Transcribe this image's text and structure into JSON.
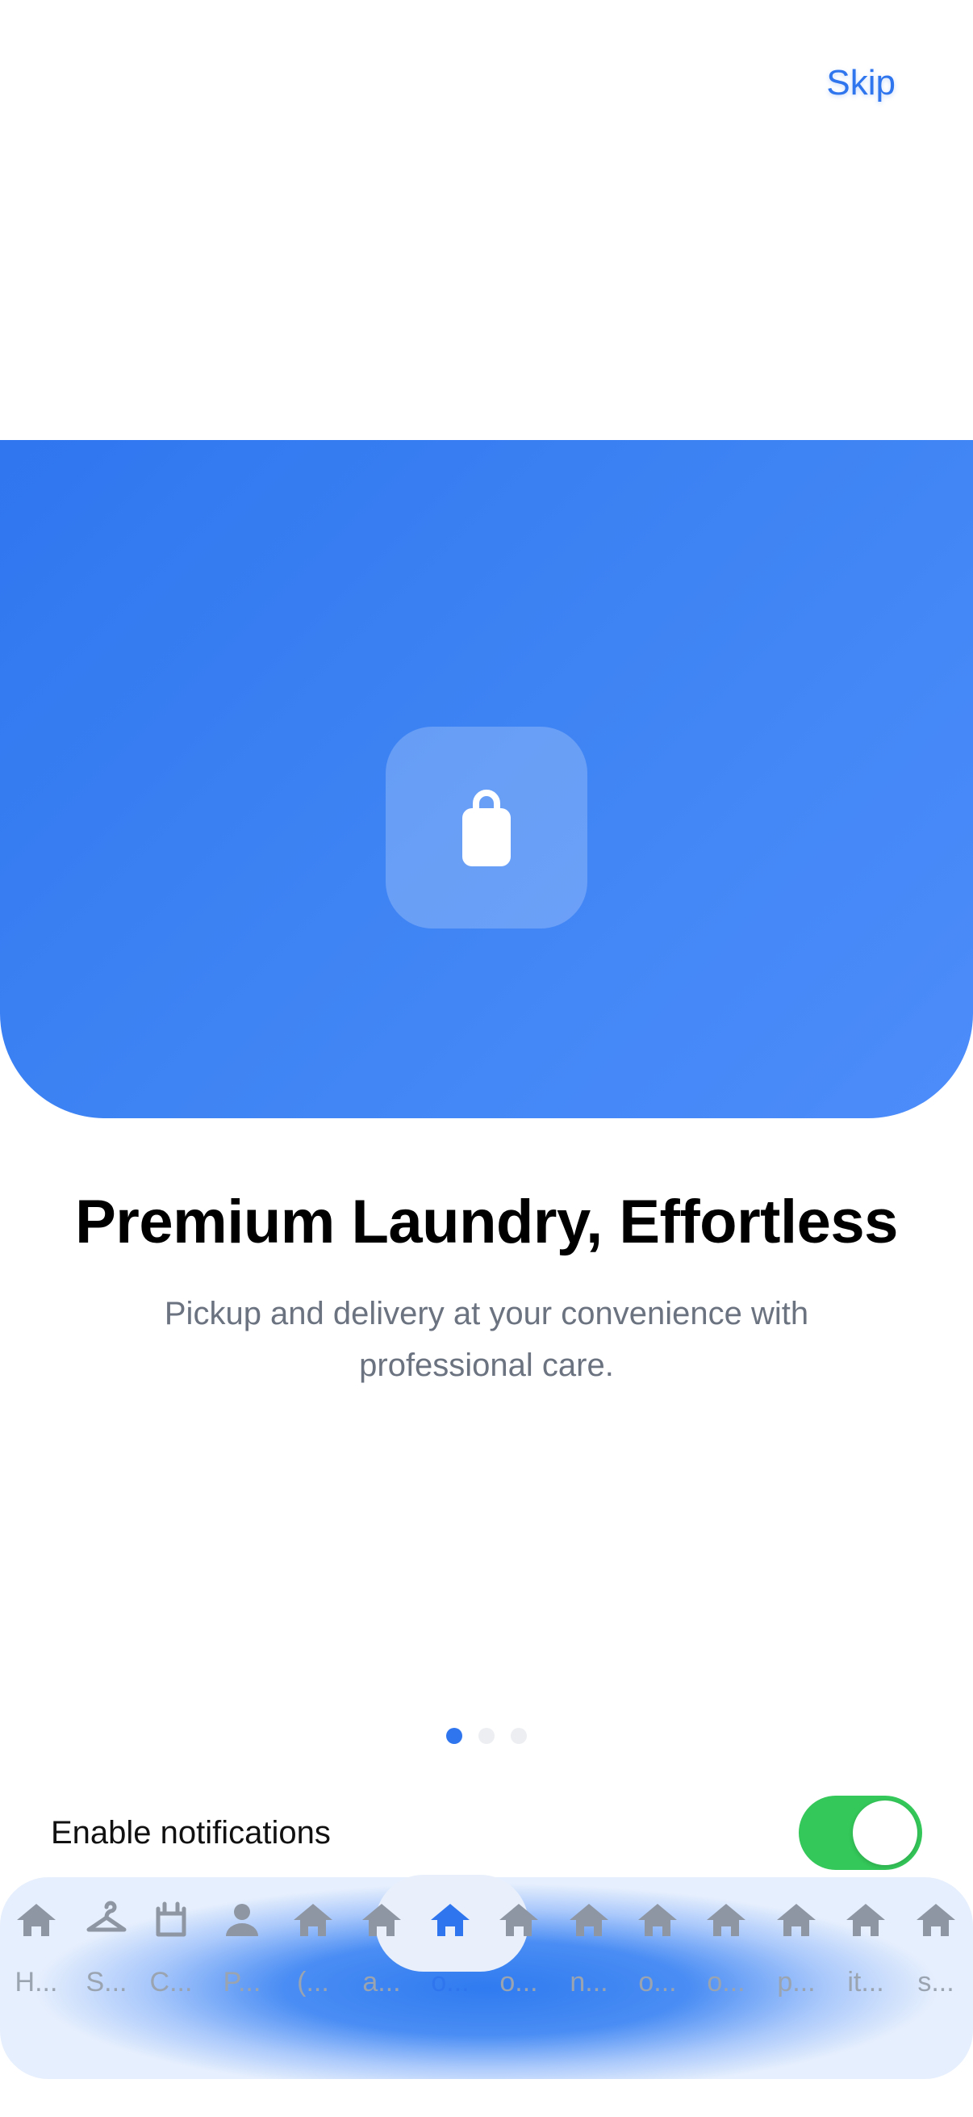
{
  "header": {
    "skip_label": "Skip"
  },
  "hero": {
    "icon": "shopping-bag-icon",
    "gradient_start": "#2f76ef",
    "gradient_end": "#4c8cfa"
  },
  "onboarding": {
    "title": "Premium Laundry, Effortless",
    "subtitle": "Pickup and delivery at your convenience with professional care.",
    "page_count": 3,
    "active_page": 1
  },
  "notifications": {
    "label": "Enable notifications",
    "enabled": true,
    "toggle_color": "#34c759"
  },
  "tabbar": {
    "active_index": 6,
    "accent": "#2f76ee",
    "tabs": [
      {
        "label": "H...",
        "icon": "home-icon"
      },
      {
        "label": "S...",
        "icon": "hanger-icon"
      },
      {
        "label": "C...",
        "icon": "basket-icon"
      },
      {
        "label": "P...",
        "icon": "person-icon"
      },
      {
        "label": "(...",
        "icon": "home-icon"
      },
      {
        "label": "a...",
        "icon": "home-icon"
      },
      {
        "label": "o...",
        "icon": "home-icon"
      },
      {
        "label": "o...",
        "icon": "home-icon"
      },
      {
        "label": "n...",
        "icon": "home-icon"
      },
      {
        "label": "o...",
        "icon": "home-icon"
      },
      {
        "label": "o...",
        "icon": "home-icon"
      },
      {
        "label": "p...",
        "icon": "home-icon"
      },
      {
        "label": "it...",
        "icon": "home-icon"
      },
      {
        "label": "s...",
        "icon": "home-icon"
      }
    ]
  }
}
